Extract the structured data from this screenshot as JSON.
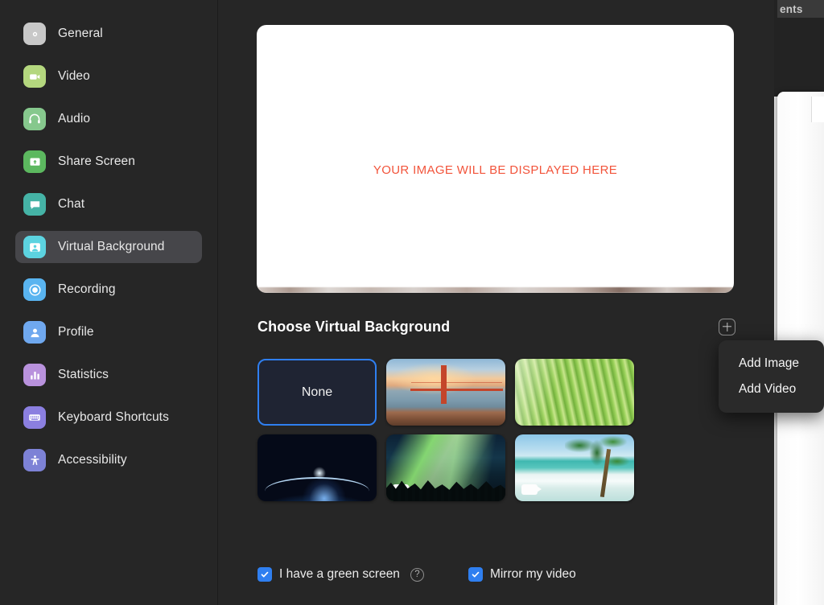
{
  "background_windows": {
    "tab_label_partial": "ents"
  },
  "sidebar": {
    "items": [
      {
        "label": "General",
        "icon": "gear-icon",
        "selected": false
      },
      {
        "label": "Video",
        "icon": "video-camera-icon",
        "selected": false
      },
      {
        "label": "Audio",
        "icon": "headphones-icon",
        "selected": false
      },
      {
        "label": "Share Screen",
        "icon": "share-screen-icon",
        "selected": false
      },
      {
        "label": "Chat",
        "icon": "chat-bubble-icon",
        "selected": false
      },
      {
        "label": "Virtual Background",
        "icon": "virtual-background-icon",
        "selected": true
      },
      {
        "label": "Recording",
        "icon": "record-icon",
        "selected": false
      },
      {
        "label": "Profile",
        "icon": "person-icon",
        "selected": false
      },
      {
        "label": "Statistics",
        "icon": "bar-chart-icon",
        "selected": false
      },
      {
        "label": "Keyboard Shortcuts",
        "icon": "keyboard-icon",
        "selected": false
      },
      {
        "label": "Accessibility",
        "icon": "accessibility-icon",
        "selected": false
      }
    ]
  },
  "preview": {
    "placeholder_text": "YOUR IMAGE WILL BE DISPLAYED HERE",
    "placeholder_color": "#f2543b"
  },
  "section": {
    "title": "Choose Virtual Background",
    "add_button_label": "+"
  },
  "thumbnails": [
    {
      "name": "None",
      "kind": "none",
      "selected": true,
      "has_video_badge": false,
      "art": "none-tile"
    },
    {
      "name": "Golden Gate Bridge",
      "kind": "image",
      "selected": false,
      "has_video_badge": false,
      "art": "art-bridge"
    },
    {
      "name": "Grass",
      "kind": "image",
      "selected": false,
      "has_video_badge": false,
      "art": "art-grass"
    },
    {
      "name": "Earth from Space",
      "kind": "image",
      "selected": false,
      "has_video_badge": false,
      "art": "art-space"
    },
    {
      "name": "Aurora Forest",
      "kind": "video",
      "selected": false,
      "has_video_badge": true,
      "art": "art-aurora"
    },
    {
      "name": "Tropical Beach",
      "kind": "video",
      "selected": false,
      "has_video_badge": true,
      "art": "art-beach"
    }
  ],
  "context_menu": {
    "visible": true,
    "items": [
      {
        "label": "Add Image"
      },
      {
        "label": "Add Video"
      }
    ]
  },
  "annotation": {
    "arrow_color": "#e8941f",
    "points_to": "Add Video"
  },
  "options": {
    "green_screen": {
      "label": "I have a green screen",
      "checked": true,
      "help_glyph": "?"
    },
    "mirror_video": {
      "label": "Mirror my video",
      "checked": true
    }
  },
  "colors": {
    "window_bg": "#262626",
    "sidebar_selected": "#46464a",
    "accent_blue": "#2f7ff0",
    "menu_bg": "#2a2a2a",
    "text_primary": "#ececec"
  }
}
